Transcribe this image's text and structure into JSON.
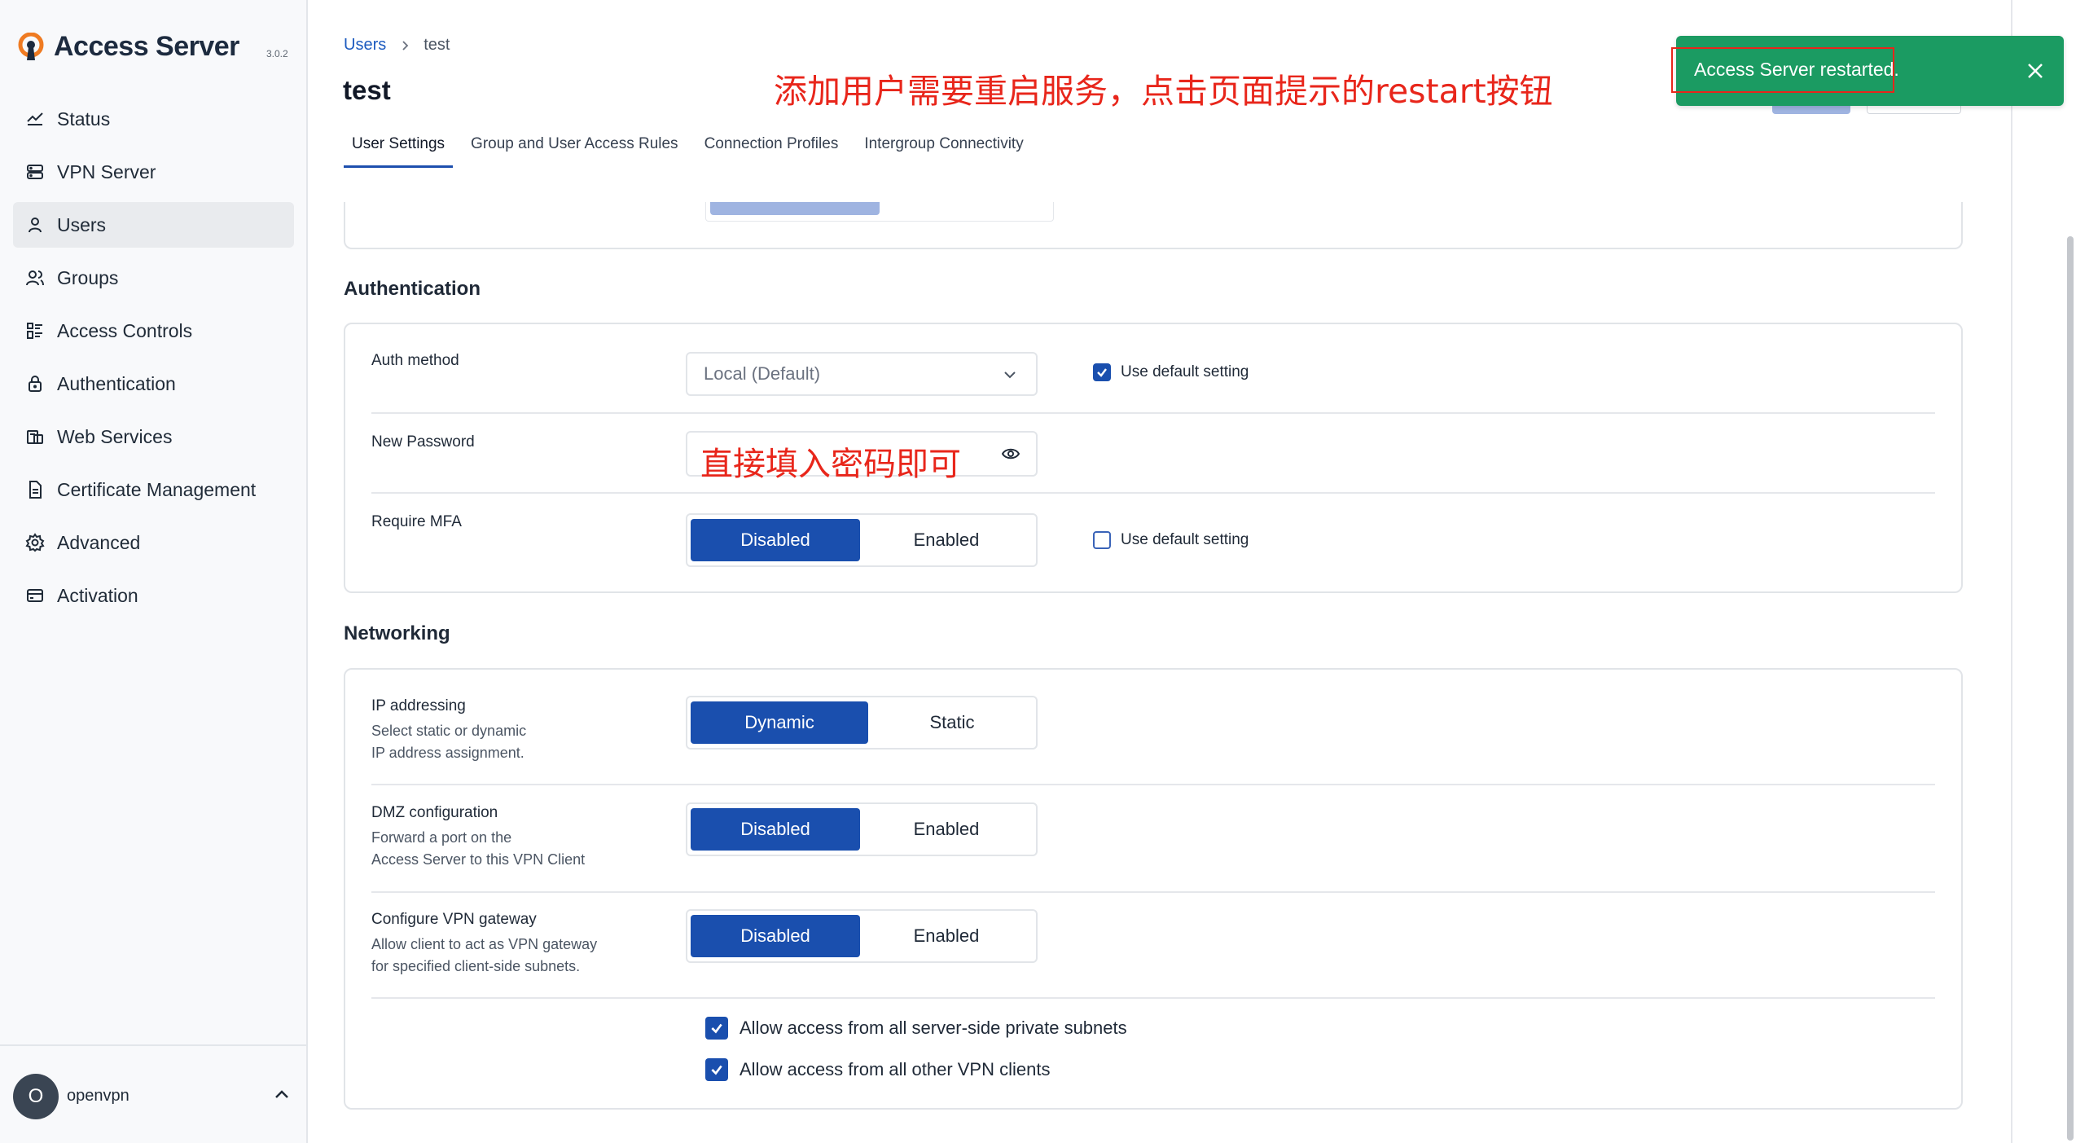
{
  "app": {
    "brand_name": "Access Server",
    "version": "3.0.2"
  },
  "sidebar": {
    "items": [
      {
        "label": "Status",
        "icon": "chart-line-icon"
      },
      {
        "label": "VPN Server",
        "icon": "server-icon"
      },
      {
        "label": "Users",
        "icon": "user-icon",
        "active": true
      },
      {
        "label": "Groups",
        "icon": "users-icon"
      },
      {
        "label": "Access Controls",
        "icon": "list-icon"
      },
      {
        "label": "Authentication",
        "icon": "lock-icon"
      },
      {
        "label": "Web Services",
        "icon": "web-services-icon"
      },
      {
        "label": "Certificate Management",
        "icon": "document-icon"
      },
      {
        "label": "Advanced",
        "icon": "gear-icon"
      },
      {
        "label": "Activation",
        "icon": "card-icon"
      }
    ],
    "footer": {
      "avatar_initial": "O",
      "username": "openvpn"
    }
  },
  "breadcrumb": {
    "parent": "Users",
    "current": "test"
  },
  "page": {
    "title": "test"
  },
  "tabs": [
    {
      "label": "User Settings",
      "active": true
    },
    {
      "label": "Group and User Access Rules"
    },
    {
      "label": "Connection Profiles"
    },
    {
      "label": "Intergroup Connectivity"
    }
  ],
  "annotations": {
    "top": "添加用户需要重启服务，点击页面提示的restart按钮",
    "password": "直接填入密码即可"
  },
  "authentication": {
    "title": "Authentication",
    "auth_method": {
      "label": "Auth method",
      "value": "Local (Default)",
      "use_default_label": "Use default setting",
      "use_default_checked": true
    },
    "new_password": {
      "label": "New Password"
    },
    "require_mfa": {
      "label": "Require MFA",
      "options": [
        "Disabled",
        "Enabled"
      ],
      "selected": "Disabled",
      "use_default_label": "Use default setting",
      "use_default_checked": false
    }
  },
  "networking": {
    "title": "Networking",
    "ip_addressing": {
      "label": "IP addressing",
      "desc_line1": "Select static or dynamic",
      "desc_line2": "IP address assignment.",
      "options": [
        "Dynamic",
        "Static"
      ],
      "selected": "Dynamic"
    },
    "dmz": {
      "label": "DMZ configuration",
      "desc_line1": "Forward a port on the",
      "desc_line2": "Access Server to this VPN Client",
      "options": [
        "Disabled",
        "Enabled"
      ],
      "selected": "Disabled"
    },
    "vpn_gateway": {
      "label": "Configure VPN gateway",
      "desc_line1": "Allow client to act as VPN gateway",
      "desc_line2": "for specified client-side subnets.",
      "options": [
        "Disabled",
        "Enabled"
      ],
      "selected": "Disabled"
    },
    "allow_private_subnets": {
      "label": "Allow access from all server-side private subnets",
      "checked": true
    },
    "allow_vpn_clients": {
      "label": "Allow access from all other VPN clients",
      "checked": true
    }
  },
  "toast": {
    "message": "Access Server restarted.",
    "color": "#1b9b62"
  },
  "colors": {
    "accent": "#1a4fae",
    "annotation": "#e8261b"
  }
}
